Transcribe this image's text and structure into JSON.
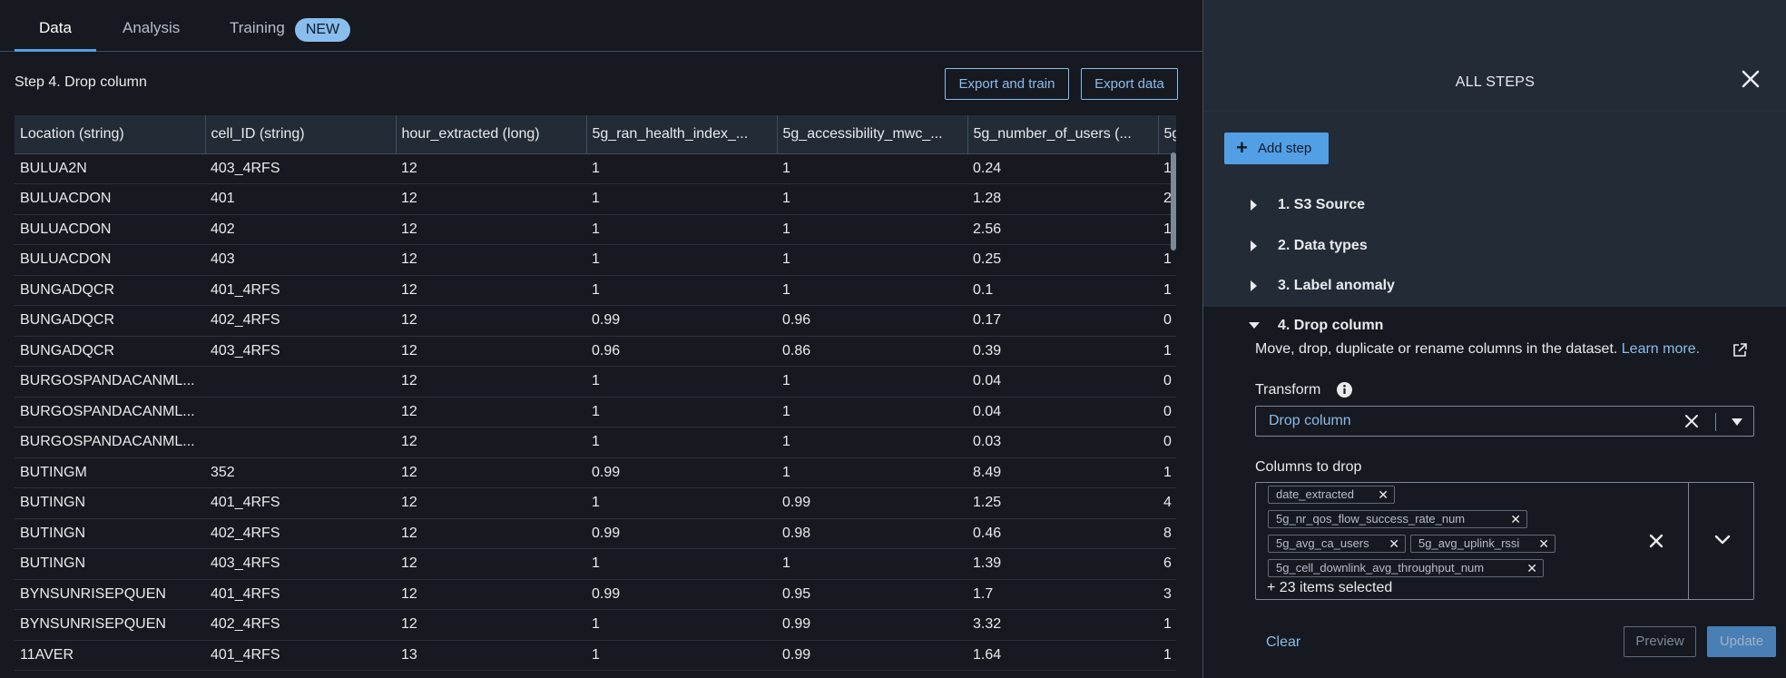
{
  "tabs": [
    {
      "label": "Data"
    },
    {
      "label": "Analysis"
    },
    {
      "label": "Training"
    }
  ],
  "training_badge": "NEW",
  "step_title": "Step 4. Drop column",
  "buttons": {
    "export_train": "Export and train",
    "export_data": "Export data"
  },
  "table": {
    "columns": [
      "Location (string)",
      "cell_ID (string)",
      "hour_extracted (long)",
      "5g_ran_health_index_...",
      "5g_accessibility_mwc_...",
      "5g_number_of_users (...",
      "5g"
    ],
    "rows": [
      [
        "BULUA2N",
        "403_4RFS",
        "12",
        "1",
        "1",
        "0.24",
        "1"
      ],
      [
        "BULUACDON",
        "401",
        "12",
        "1",
        "1",
        "1.28",
        "2"
      ],
      [
        "BULUACDON",
        "402",
        "12",
        "1",
        "1",
        "2.56",
        "1"
      ],
      [
        "BULUACDON",
        "403",
        "12",
        "1",
        "1",
        "0.25",
        "1"
      ],
      [
        "BUNGADQCR",
        "401_4RFS",
        "12",
        "1",
        "1",
        "0.1",
        "1"
      ],
      [
        "BUNGADQCR",
        "402_4RFS",
        "12",
        "0.99",
        "0.96",
        "0.17",
        "0"
      ],
      [
        "BUNGADQCR",
        "403_4RFS",
        "12",
        "0.96",
        "0.86",
        "0.39",
        "1"
      ],
      [
        "BURGOSPANDACANML...",
        "",
        "12",
        "1",
        "1",
        "0.04",
        "0"
      ],
      [
        "BURGOSPANDACANML...",
        "",
        "12",
        "1",
        "1",
        "0.04",
        "0"
      ],
      [
        "BURGOSPANDACANML...",
        "",
        "12",
        "1",
        "1",
        "0.03",
        "0"
      ],
      [
        "BUTINGM",
        "352",
        "12",
        "0.99",
        "1",
        "8.49",
        "1"
      ],
      [
        "BUTINGN",
        "401_4RFS",
        "12",
        "1",
        "0.99",
        "1.25",
        "4"
      ],
      [
        "BUTINGN",
        "402_4RFS",
        "12",
        "0.99",
        "0.98",
        "0.46",
        "8"
      ],
      [
        "BUTINGN",
        "403_4RFS",
        "12",
        "1",
        "1",
        "1.39",
        "6"
      ],
      [
        "BYNSUNRISEPQUEN",
        "401_4RFS",
        "12",
        "0.99",
        "0.95",
        "1.7",
        "3"
      ],
      [
        "BYNSUNRISEPQUEN",
        "402_4RFS",
        "12",
        "1",
        "0.99",
        "3.32",
        "1"
      ],
      [
        "11AVER",
        "401_4RFS",
        "13",
        "1",
        "0.99",
        "1.64",
        "1"
      ]
    ]
  },
  "panel": {
    "title": "ALL STEPS",
    "add_step": "Add step",
    "steps": [
      {
        "label": "1. S3 Source",
        "expanded": false
      },
      {
        "label": "2. Data types",
        "expanded": false
      },
      {
        "label": "3. Label anomaly",
        "expanded": false
      },
      {
        "label": "4. Drop column",
        "expanded": true
      }
    ],
    "description": "Move, drop, duplicate or rename columns in the dataset.",
    "learn_more": "Learn more.",
    "transform_label": "Transform",
    "transform_value": "Drop column",
    "columns_to_drop_label": "Columns to drop",
    "tokens": [
      "date_extracted",
      "5g_nr_qos_flow_success_rate_num",
      "5g_avg_ca_users",
      "5g_avg_uplink_rssi",
      "5g_cell_downlink_avg_throughput_num"
    ],
    "more_selected": "+ 23 items selected",
    "clear": "Clear",
    "preview": "Preview",
    "update": "Update"
  },
  "colors": {
    "accent": "#539fe5",
    "link": "#89bdee",
    "background": "#16191f",
    "panel": "#232b37"
  }
}
